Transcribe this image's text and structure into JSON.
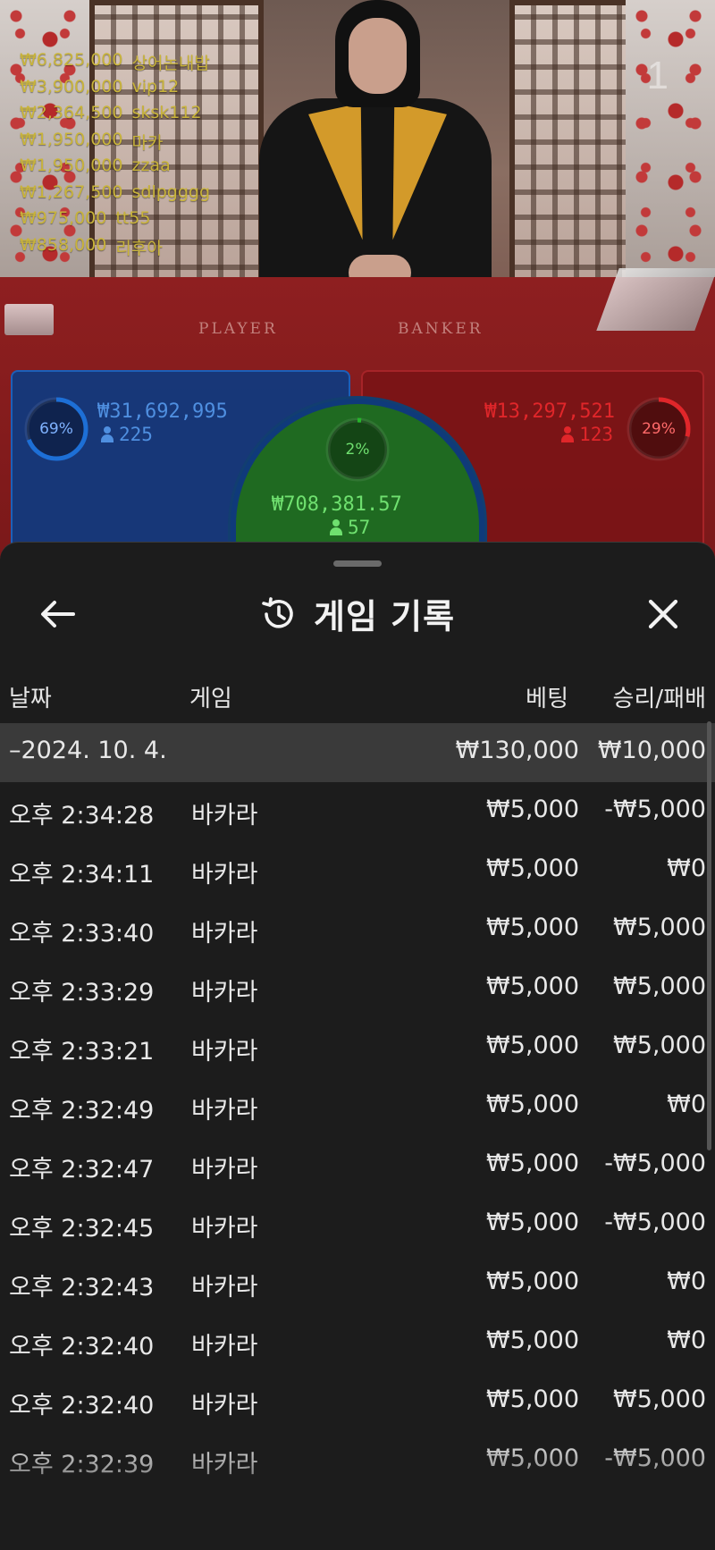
{
  "video": {
    "round_number": "1",
    "table_labels": {
      "player": "PLAYER",
      "banker": "BANKER"
    },
    "winners": [
      {
        "amount": "₩6,825,000",
        "name": "상어논내밥"
      },
      {
        "amount": "₩3,900,000",
        "name": "vip12"
      },
      {
        "amount": "₩2,364,500",
        "name": "sksk112"
      },
      {
        "amount": "₩1,950,000",
        "name": "마카"
      },
      {
        "amount": "₩1,950,000",
        "name": "zzaa"
      },
      {
        "amount": "₩1,267,500",
        "name": "sdlpgggg"
      },
      {
        "amount": "₩975,000",
        "name": "tt55"
      },
      {
        "amount": "₩858,000",
        "name": "리후아"
      }
    ]
  },
  "bets": {
    "player": {
      "percent_label": "69%",
      "percent": 69,
      "amount": "₩31,692,995",
      "players": "225",
      "color": "#1d6fd6"
    },
    "tie": {
      "percent_label": "2%",
      "percent": 2,
      "amount": "₩708,381.57",
      "players": "57",
      "color": "#27b32b"
    },
    "banker": {
      "percent_label": "29%",
      "percent": 29,
      "amount": "₩13,297,521",
      "players": "123",
      "color": "#e0262a"
    }
  },
  "sheet": {
    "title": "게임 기록",
    "back_icon": "arrow-left-icon",
    "history_icon": "history-clock-icon",
    "close_icon": "close-icon",
    "columns": {
      "date": "날짜",
      "game": "게임",
      "bet": "베팅",
      "result": "승리/패배"
    },
    "day_summary": {
      "date": "–2024. 10. 4.",
      "bet": "₩130,000",
      "result": "₩10,000"
    },
    "rows": [
      {
        "time": "오후 2:34:28",
        "game": "바카라",
        "bet": "₩5,000",
        "result": "-₩5,000"
      },
      {
        "time": "오후 2:34:11",
        "game": "바카라",
        "bet": "₩5,000",
        "result": "₩0"
      },
      {
        "time": "오후 2:33:40",
        "game": "바카라",
        "bet": "₩5,000",
        "result": "₩5,000"
      },
      {
        "time": "오후 2:33:29",
        "game": "바카라",
        "bet": "₩5,000",
        "result": "₩5,000"
      },
      {
        "time": "오후 2:33:21",
        "game": "바카라",
        "bet": "₩5,000",
        "result": "₩5,000"
      },
      {
        "time": "오후 2:32:49",
        "game": "바카라",
        "bet": "₩5,000",
        "result": "₩0"
      },
      {
        "time": "오후 2:32:47",
        "game": "바카라",
        "bet": "₩5,000",
        "result": "-₩5,000"
      },
      {
        "time": "오후 2:32:45",
        "game": "바카라",
        "bet": "₩5,000",
        "result": "-₩5,000"
      },
      {
        "time": "오후 2:32:43",
        "game": "바카라",
        "bet": "₩5,000",
        "result": "₩0"
      },
      {
        "time": "오후 2:32:40",
        "game": "바카라",
        "bet": "₩5,000",
        "result": "₩0"
      },
      {
        "time": "오후 2:32:40",
        "game": "바카라",
        "bet": "₩5,000",
        "result": "₩5,000"
      },
      {
        "time": "오후 2:32:39",
        "game": "바카라",
        "bet": "₩5,000",
        "result": "-₩5,000"
      }
    ]
  }
}
